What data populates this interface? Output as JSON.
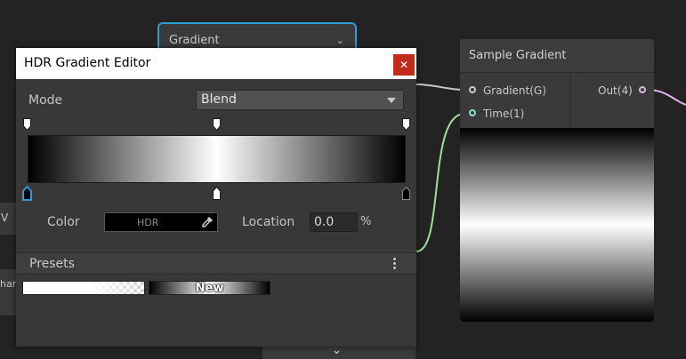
{
  "background_nodes": {
    "gradient_node_title": "Gradient",
    "left_node_a_text": "V",
    "left_node_b_text": "har"
  },
  "sample_node": {
    "title": "Sample Gradient",
    "inputs": [
      {
        "label": "Gradient(G)",
        "port_color": "#c8c8c8"
      },
      {
        "label": "Time(1)",
        "port_color": "#8fdcd0"
      }
    ],
    "output": {
      "label": "Out(4)",
      "port_color": "#e0b4e8"
    }
  },
  "editor": {
    "title": "HDR Gradient Editor",
    "close_icon": "close-icon",
    "mode_label": "Mode",
    "mode_value": "Blend",
    "color_label": "Color",
    "color_field_text": "HDR",
    "picker_icon": "eyedropper-icon",
    "location_label": "Location",
    "location_value": "0.0",
    "location_unit": "%",
    "presets_label": "Presets",
    "presets_menu_icon": "kebab-menu-icon",
    "presets": [
      {
        "label": ""
      },
      {
        "label": "New"
      }
    ]
  },
  "colors": {
    "accent_blue": "#2f9bd6",
    "close_red": "#c42b1c",
    "wire_green": "#9ee09a",
    "wire_pink": "#e0b4e8"
  }
}
